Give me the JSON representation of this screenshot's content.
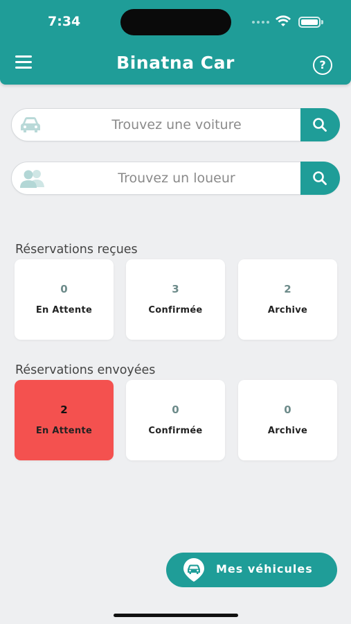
{
  "status_bar": {
    "time": "7:34"
  },
  "header": {
    "title": "Binatna Car",
    "help_label": "?"
  },
  "search_car": {
    "placeholder": "Trouvez une voiture"
  },
  "search_renter": {
    "placeholder": "Trouvez un loueur"
  },
  "received": {
    "title": "Réservations reçues",
    "cards": [
      {
        "count": "0",
        "label": "En Attente"
      },
      {
        "count": "3",
        "label": "Confirmée"
      },
      {
        "count": "2",
        "label": "Archive"
      }
    ]
  },
  "sent": {
    "title": "Réservations envoyées",
    "cards": [
      {
        "count": "2",
        "label": "En Attente"
      },
      {
        "count": "0",
        "label": "Confirmée"
      },
      {
        "count": "0",
        "label": "Archive"
      }
    ]
  },
  "fab": {
    "label": "Mes véhicules"
  },
  "colors": {
    "primary": "#1f9d98",
    "highlight": "#f4514f",
    "background": "#eeeff1"
  },
  "icons": {
    "menu": "menu-icon",
    "help": "help-icon",
    "car": "car-icon",
    "users": "users-icon",
    "search": "search-icon",
    "vehicle_pin": "vehicle-pin-icon"
  }
}
